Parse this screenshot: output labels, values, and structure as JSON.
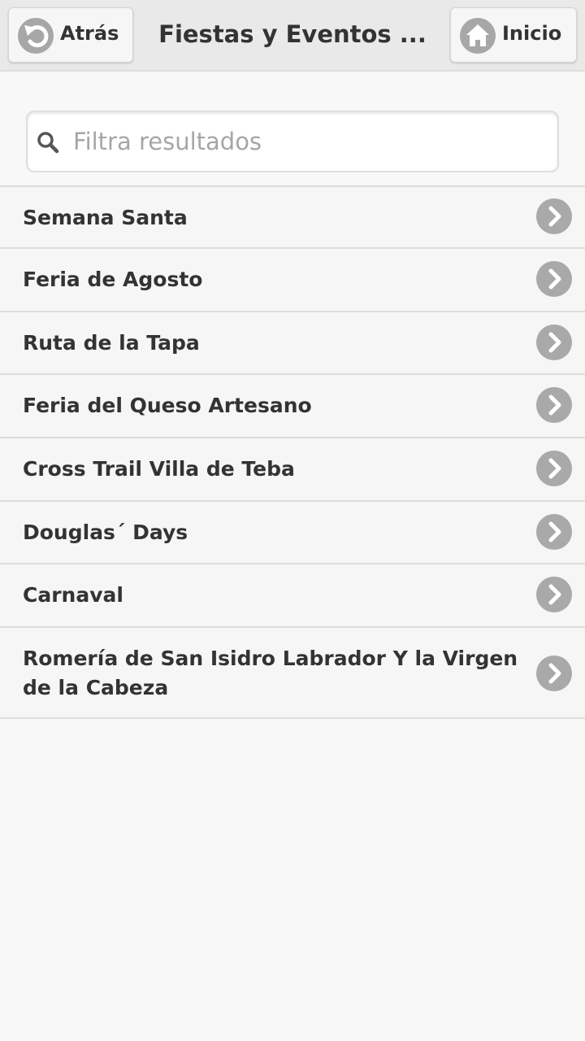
{
  "header": {
    "title": "Fiestas y Eventos ...",
    "back_label": "Atrás",
    "home_label": "Inicio"
  },
  "search": {
    "placeholder": "Filtra resultados",
    "value": ""
  },
  "items": [
    {
      "label": "Semana Santa"
    },
    {
      "label": "Feria de Agosto"
    },
    {
      "label": "Ruta de la Tapa"
    },
    {
      "label": "Feria del Queso Artesano"
    },
    {
      "label": "Cross Trail Villa de Teba"
    },
    {
      "label": "Douglas´ Days"
    },
    {
      "label": "Carnaval"
    },
    {
      "label": "Romería de San Isidro Labrador Y la Virgen de la Cabeza"
    }
  ],
  "icons": {
    "back": "undo-arrow-icon",
    "home": "home-icon",
    "search": "search-icon",
    "item": "chevron-right-icon"
  },
  "colors": {
    "header_bg": "#e9e9e9",
    "page_bg": "#f8f8f8",
    "icon_circle": "#a9a9a9",
    "text": "#333333",
    "placeholder": "#a6a6a6"
  }
}
